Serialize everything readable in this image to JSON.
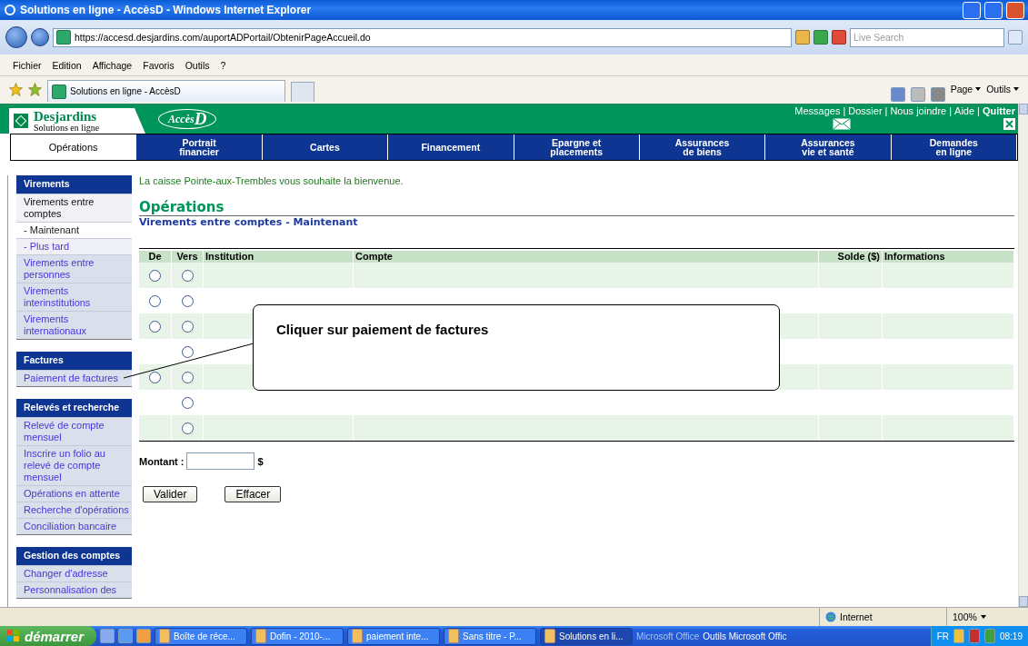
{
  "browser": {
    "title": "Solutions en ligne - AccèsD - Windows Internet Explorer",
    "url": "https://accesd.desjardins.com/auportADPortail/ObtenirPageAccueil.do",
    "search": {
      "placeholder": "Live Search"
    },
    "menu": [
      "Fichier",
      "Edition",
      "Affichage",
      "Favoris",
      "Outils",
      "?"
    ],
    "tab": "Solutions en ligne - AccèsD",
    "toolbar": [
      "Page",
      "Outils"
    ]
  },
  "header": {
    "brand": "Desjardins",
    "tagline": "Solutions en ligne",
    "product": "Accès",
    "product_mark": "D",
    "links": [
      "Messages",
      "Dossier",
      "Nous joindre",
      "Aide",
      "Quitter"
    ],
    "separator": "|"
  },
  "nav": [
    {
      "label": "Opérations",
      "selected": true
    },
    {
      "label": "Portrait\nfinancier",
      "selected": false
    },
    {
      "label": "Cartes",
      "selected": false
    },
    {
      "label": "Financement",
      "selected": false
    },
    {
      "label": "Epargne et\nplacements",
      "selected": false
    },
    {
      "label": "Assurances\nde biens",
      "selected": false
    },
    {
      "label": "Assurances\nvie et santé",
      "selected": false
    },
    {
      "label": "Demandes\nen ligne",
      "selected": false
    }
  ],
  "sidebar": [
    {
      "title": "Virements",
      "items": [
        {
          "label": "Virements entre comptes",
          "kind": "open",
          "selected": false
        },
        {
          "label": "- Maintenant",
          "kind": "sub",
          "selected": true
        },
        {
          "label": "- Plus tard",
          "kind": "sub",
          "selected": false
        },
        {
          "label": "Virements entre personnes",
          "kind": "link",
          "selected": false
        },
        {
          "label": "Virements interinstitutions",
          "kind": "link",
          "selected": false
        },
        {
          "label": "Virements internationaux",
          "kind": "link",
          "selected": false
        }
      ]
    },
    {
      "title": "Factures",
      "items": [
        {
          "label": "Paiement de factures",
          "kind": "link",
          "selected": false
        }
      ]
    },
    {
      "title": "Relevés et recherche",
      "items": [
        {
          "label": "Relevé de compte mensuel",
          "kind": "link",
          "selected": false
        },
        {
          "label": "Inscrire un folio au relevé de compte mensuel",
          "kind": "link",
          "selected": false
        },
        {
          "label": "Opérations en attente",
          "kind": "link",
          "selected": false
        },
        {
          "label": "Recherche d'opérations",
          "kind": "link",
          "selected": false
        },
        {
          "label": "Conciliation bancaire",
          "kind": "link",
          "selected": false
        }
      ]
    },
    {
      "title": "Gestion des comptes",
      "items": [
        {
          "label": "Changer d'adresse",
          "kind": "link",
          "selected": false
        },
        {
          "label": "Personnalisation des",
          "kind": "link",
          "selected": false
        }
      ]
    }
  ],
  "main": {
    "welcome": "La caisse Pointe-aux-Trembles vous souhaite la bienvenue.",
    "heading": "Opérations",
    "subheading": "Virements entre comptes - Maintenant",
    "table": {
      "columns": [
        "De",
        "Vers",
        "Institution",
        "Compte",
        "Solde ($)",
        "Informations"
      ],
      "rows": [
        {
          "kind": "both",
          "from_selected": false,
          "to_selected": false
        },
        {
          "kind": "both",
          "from_selected": false,
          "to_selected": false
        },
        {
          "kind": "both",
          "from_selected": false,
          "to_selected": false
        },
        {
          "kind": "to_only",
          "to_selected": false
        },
        {
          "kind": "both",
          "from_selected": false,
          "to_selected": false
        },
        {
          "kind": "to_only",
          "to_selected": false
        },
        {
          "kind": "to_only",
          "to_selected": false
        }
      ]
    },
    "amount": {
      "label": "Montant :",
      "currency": "$"
    },
    "buttons": [
      "Valider",
      "Effacer"
    ]
  },
  "callout": "Cliquer sur paiement de factures",
  "status_bar": {
    "zone": "Internet",
    "zoom": "100%"
  },
  "taskbar": {
    "start": "démarrer",
    "windows": [
      {
        "label": "Boîte de réce...",
        "selected": false
      },
      {
        "label": "Dofin - 2010-...",
        "selected": false
      },
      {
        "label": "paiement inte...",
        "selected": false
      },
      {
        "label": "Sans titre - P...",
        "selected": false
      },
      {
        "label": "Solutions en li...",
        "selected": true
      }
    ],
    "office": "Microsoft Office",
    "office_tool": "Outils Microsoft Offic",
    "lang": "FR",
    "time": "08:19"
  }
}
